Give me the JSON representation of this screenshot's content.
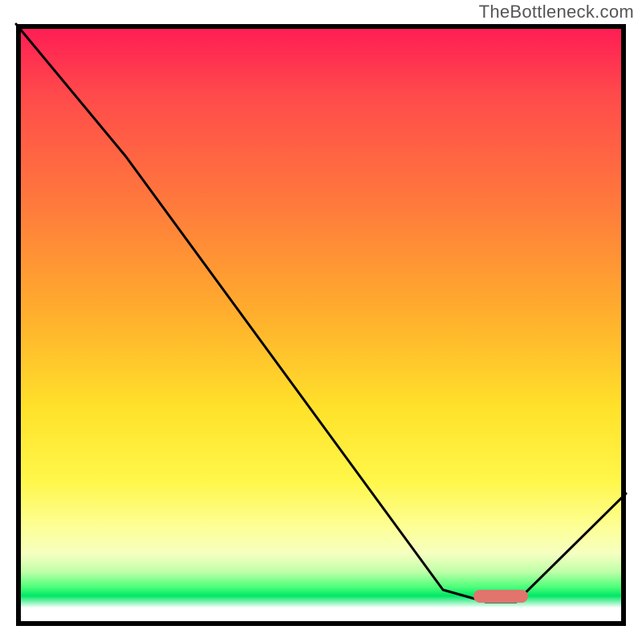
{
  "watermark": "TheBottleneck.com",
  "chart_data": {
    "type": "line",
    "title": "",
    "xlabel": "",
    "ylabel": "",
    "xlim": [
      0,
      100
    ],
    "ylim": [
      0,
      100
    ],
    "grid": false,
    "legend": false,
    "series": [
      {
        "name": "bottleneck-curve",
        "x": [
          0,
          18,
          70,
          77,
          82,
          100
        ],
        "values": [
          100,
          78,
          6,
          4,
          4,
          22
        ]
      }
    ],
    "marker": {
      "x_start": 75,
      "x_end": 84,
      "y": 5,
      "color": "#e2746e"
    },
    "gradient_stops": [
      {
        "pos": 0,
        "color": "#ff1a55"
      },
      {
        "pos": 12,
        "color": "#ff4b4b"
      },
      {
        "pos": 30,
        "color": "#ff7a3c"
      },
      {
        "pos": 48,
        "color": "#ffae2d"
      },
      {
        "pos": 64,
        "color": "#ffe22a"
      },
      {
        "pos": 76,
        "color": "#fff74a"
      },
      {
        "pos": 84,
        "color": "#fdff9a"
      },
      {
        "pos": 88,
        "color": "#f5ffc0"
      },
      {
        "pos": 91,
        "color": "#bfffa8"
      },
      {
        "pos": 93.5,
        "color": "#4eff7a"
      },
      {
        "pos": 95,
        "color": "#00e765"
      },
      {
        "pos": 97,
        "color": "#ffffff"
      },
      {
        "pos": 100,
        "color": "#ffffff"
      }
    ]
  }
}
